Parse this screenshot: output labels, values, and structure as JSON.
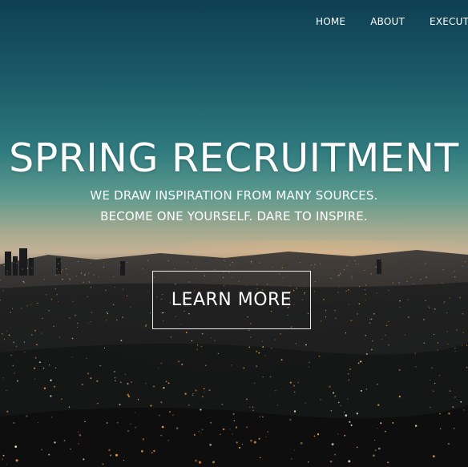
{
  "nav": {
    "items": [
      {
        "label": "HOME"
      },
      {
        "label": "ABOUT"
      },
      {
        "label": "EXECUTIV"
      }
    ]
  },
  "hero": {
    "title": "SPRING RECRUITMENT",
    "tagline_line1": "WE DRAW INSPIRATION FROM MANY SOURCES.",
    "tagline_line2": "BECOME ONE YOURSELF. DARE TO INSPIRE.",
    "cta_label": "LEARN MORE",
    "background_image": "night city skyline with teal dusk sky"
  },
  "colors": {
    "text": "#ffffff",
    "sky_top": "#0e3f52",
    "sky_mid": "#2e7a7e",
    "horizon": "#c4b196",
    "city_dark": "#101112",
    "city_lights": "#f2a850"
  }
}
